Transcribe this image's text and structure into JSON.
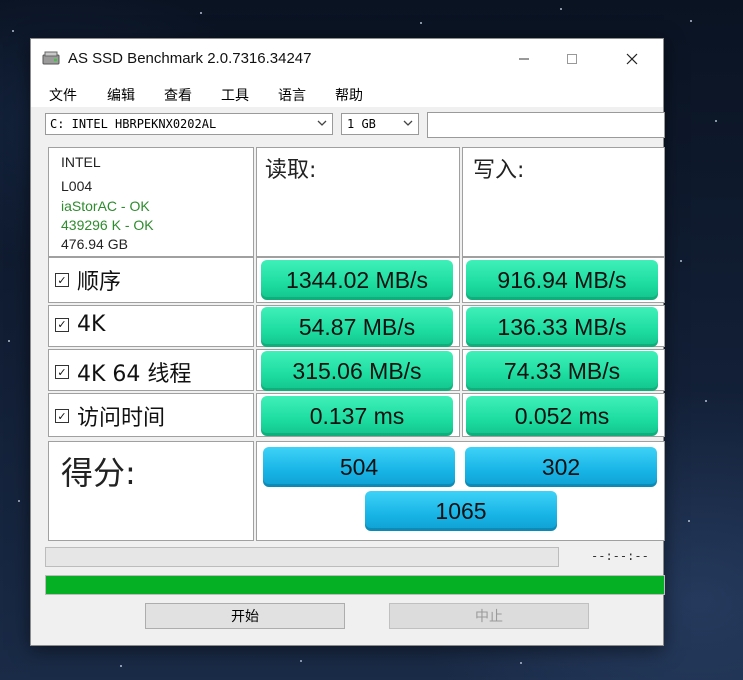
{
  "window": {
    "title": "AS SSD Benchmark 2.0.7316.34247"
  },
  "menu": [
    "文件",
    "编辑",
    "查看",
    "工具",
    "语言",
    "帮助"
  ],
  "toolbar": {
    "drive": "C: INTEL HBRPEKNX0202AL",
    "size": "1 GB",
    "extra_value": ""
  },
  "drive_info": {
    "vendor": "INTEL",
    "firmware": "L004",
    "driver_status": "iaStorAC - OK",
    "alignment_status": "439296 K - OK",
    "capacity": "476.94 GB"
  },
  "columns": {
    "read": "读取:",
    "write": "写入:"
  },
  "rows": [
    {
      "label": "顺序",
      "read": "1344.02 MB/s",
      "write": "916.94 MB/s"
    },
    {
      "label": "4K",
      "read": "54.87 MB/s",
      "write": "136.33 MB/s"
    },
    {
      "label": "4K 64 线程",
      "read": "315.06 MB/s",
      "write": "74.33 MB/s"
    },
    {
      "label": "访问时间",
      "read": "0.137 ms",
      "write": "0.052 ms"
    }
  ],
  "score": {
    "label": "得分:",
    "read": "504",
    "write": "302",
    "total": "1065"
  },
  "status": {
    "elapsed": "--:--:--",
    "overall_progress": 1.0,
    "progress_color": "#06b025"
  },
  "buttons": {
    "start": "开始",
    "stop": "中止"
  },
  "colors": {
    "value_green": "#1ddca0",
    "score_blue": "#18b4e6",
    "ok_green": "#2e8b2e"
  },
  "icons": {
    "app": "hard-drive-icon",
    "minimize": "minimize-icon",
    "maximize": "maximize-icon",
    "close": "close-icon"
  }
}
